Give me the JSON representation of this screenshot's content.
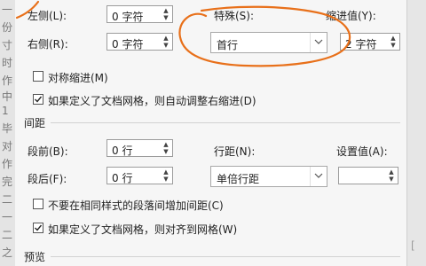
{
  "document_strip": [
    "一",
    "份",
    "寸",
    "时",
    "作",
    "中",
    "1",
    "毕",
    "对",
    "作",
    "完",
    "二",
    "一",
    "二",
    "之"
  ],
  "indent": {
    "left": {
      "label": "左侧(L):",
      "value": "0 字符"
    },
    "right": {
      "label": "右侧(R):",
      "value": "0 字符"
    },
    "special": {
      "label": "特殊(S):",
      "value": "首行"
    },
    "indent_by": {
      "label": "缩进值(Y):",
      "value": "2 字符"
    },
    "mirror_indents": {
      "label": "对称缩进(M)",
      "checked": false
    },
    "auto_adjust_right": {
      "label": "如果定义了文档网格，则自动调整右缩进(D)",
      "checked": true
    }
  },
  "spacing": {
    "section_title": "间距",
    "before": {
      "label": "段前(B):",
      "value": "0 行"
    },
    "after": {
      "label": "段后(F):",
      "value": "0 行"
    },
    "line_spacing": {
      "label": "行距(N):",
      "value": "单倍行距"
    },
    "at": {
      "label": "设置值(A):",
      "value": ""
    },
    "dont_add_space": {
      "label": "不要在相同样式的段落间增加间距(C)",
      "checked": false
    },
    "snap_to_grid": {
      "label": "如果定义了文档网格，则对齐到网格(W)",
      "checked": true
    }
  },
  "preview": {
    "section_title": "预览"
  },
  "annotation_color": "#e8701a"
}
